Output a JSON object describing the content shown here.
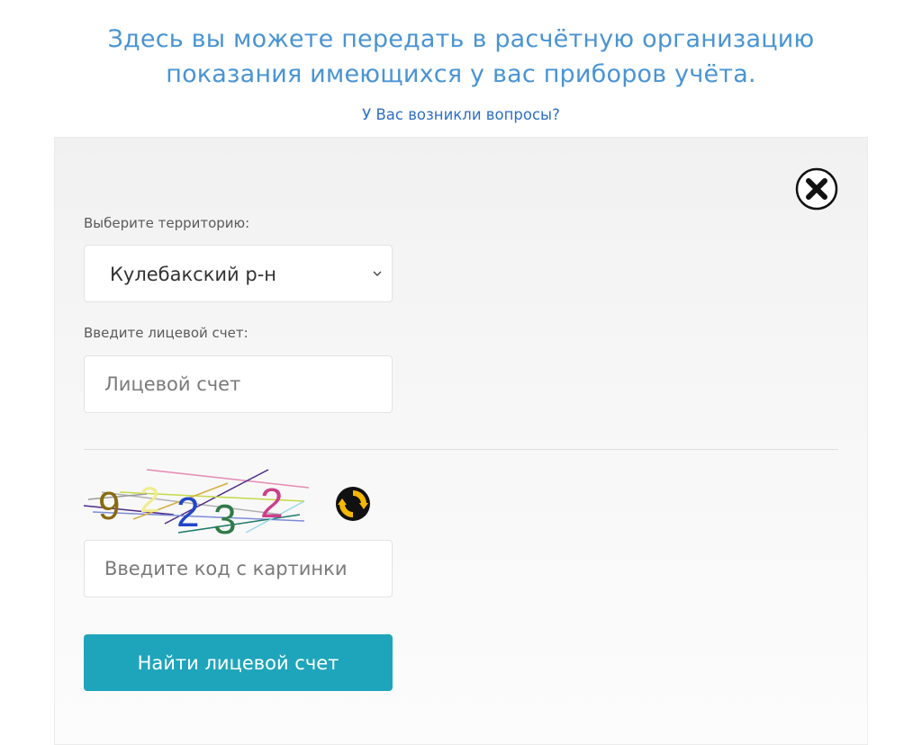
{
  "header": {
    "headline_line1": "Здесь вы можете передать в расчётную организацию",
    "headline_line2": "показания имеющихся у вас приборов учёта.",
    "questions_link": "У Вас возникли вопросы?"
  },
  "form": {
    "territory_label": "Выберите территорию:",
    "territory_value": "Кулебакский р-н",
    "account_label": "Введите лицевой счет:",
    "account_placeholder": "Лицевой счет",
    "captcha_digits": [
      "9",
      "2",
      "2",
      "3",
      "2"
    ],
    "captcha_placeholder": "Введите код с картинки",
    "submit_label": "Найти лицевой счет"
  },
  "icons": {
    "close": "close-icon",
    "refresh": "refresh-icon",
    "chevron": "chevron-down-icon"
  },
  "colors": {
    "headline": "#4a94d2",
    "link": "#2f6fc4",
    "button": "#1ea5bb",
    "refresh_accent": "#f5b800"
  }
}
